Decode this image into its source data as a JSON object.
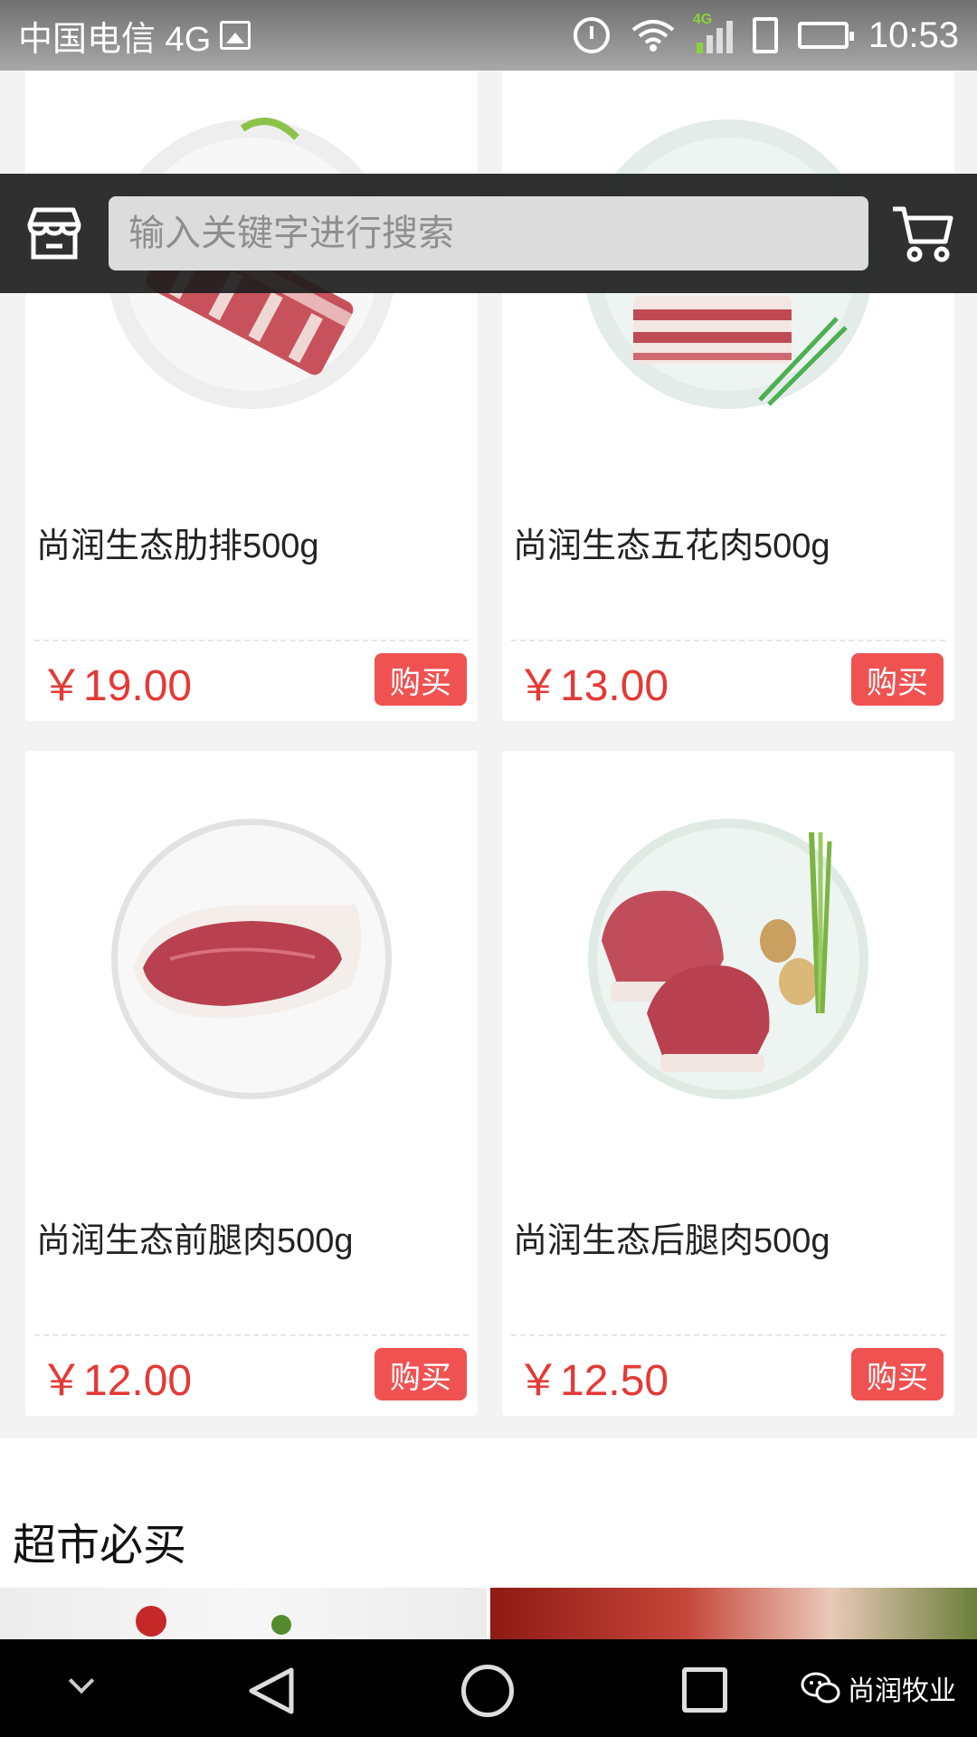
{
  "status_bar": {
    "carrier": "中国电信 4G",
    "network_tag": "4G",
    "time": "10:53"
  },
  "search": {
    "placeholder": "输入关键字进行搜索"
  },
  "products": [
    {
      "name": "尚润生态肋排500g",
      "price": "￥19.00",
      "buy_label": "购买",
      "image": "pork-ribs-plate"
    },
    {
      "name": "尚润生态五花肉500g",
      "price": "￥13.00",
      "buy_label": "购买",
      "image": "pork-belly-plate"
    },
    {
      "name": "尚润生态前腿肉500g",
      "price": "￥12.00",
      "buy_label": "购买",
      "image": "front-leg-pork-plate"
    },
    {
      "name": "尚润生态后腿肉500g",
      "price": "￥12.50",
      "buy_label": "购买",
      "image": "hind-leg-pork-plate"
    }
  ],
  "section": {
    "title": "超市必买"
  },
  "watermark": {
    "text": "尚润牧业",
    "icon": "wechat-icon"
  },
  "colors": {
    "price": "#e53935",
    "buy_button": "#f05252",
    "header_bg": "#1e1e1e"
  }
}
